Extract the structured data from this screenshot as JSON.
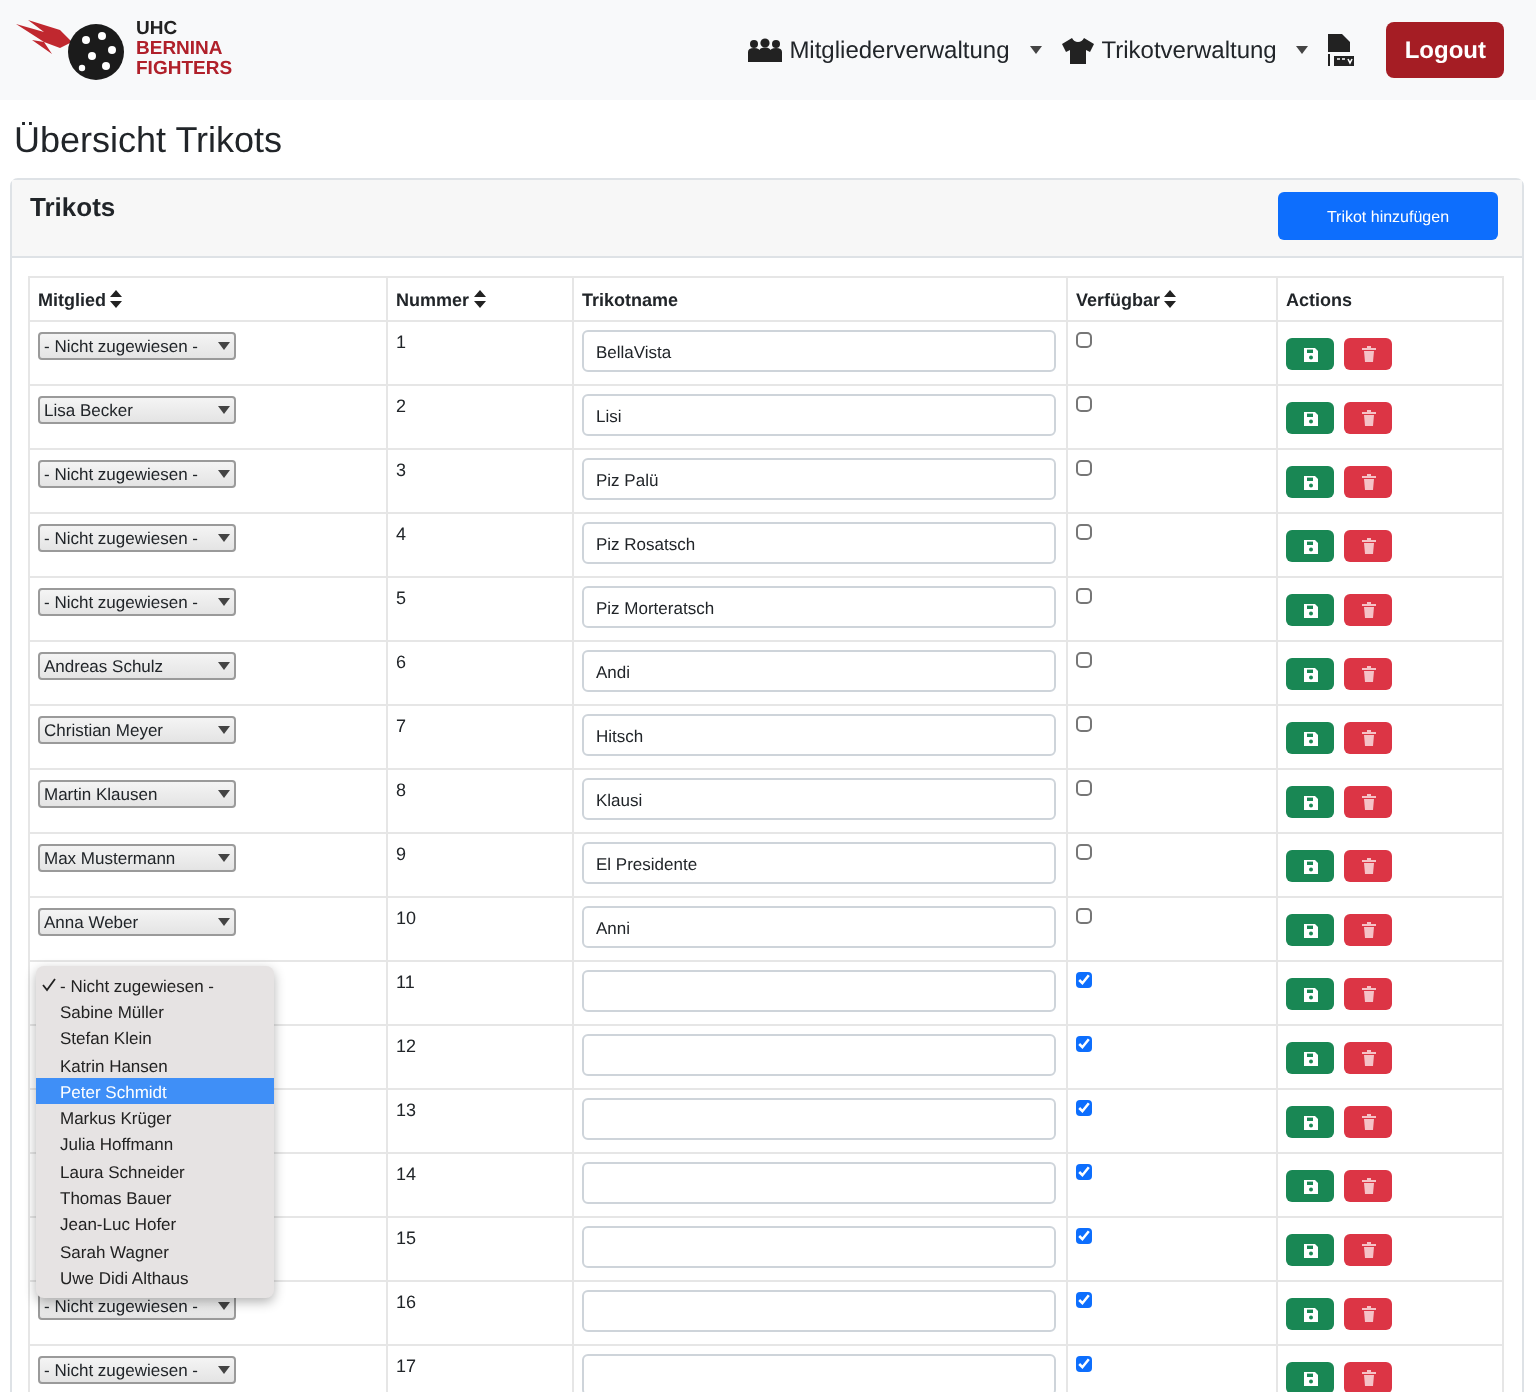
{
  "brand": {
    "line_1": "UHC",
    "line_2": "BERNINA",
    "line_3": "FIGHTERS"
  },
  "nav": [
    {
      "label": "Mitgliederverwaltung",
      "kind": "people"
    },
    {
      "label": "Trikotverwaltung",
      "kind": "shirt"
    }
  ],
  "logout": "Logout",
  "page_title": "Übersicht Trikots",
  "card": {
    "title": "Trikots",
    "add_button": "Trikot hinzufügen"
  },
  "table": {
    "columns": [
      {
        "label": "Mitglied",
        "sortable": true
      },
      {
        "label": "Nummer",
        "sortable": true
      },
      {
        "label": "Trikotname",
        "sortable": false
      },
      {
        "label": "Verfügbar",
        "sortable": true
      },
      {
        "label": "Actions",
        "sortable": false
      }
    ],
    "rows": [
      {
        "member": "- Nicht zugewiesen -",
        "number": "1",
        "name": "BellaVista",
        "available": false
      },
      {
        "member": "Lisa Becker",
        "number": "2",
        "name": "Lisi",
        "available": false
      },
      {
        "member": "- Nicht zugewiesen -",
        "number": "3",
        "name": "Piz Palü",
        "available": false
      },
      {
        "member": "- Nicht zugewiesen -",
        "number": "4",
        "name": "Piz Rosatsch",
        "available": false
      },
      {
        "member": "- Nicht zugewiesen -",
        "number": "5",
        "name": "Piz Morteratsch",
        "available": false
      },
      {
        "member": "Andreas Schulz",
        "number": "6",
        "name": "Andi",
        "available": false
      },
      {
        "member": "Christian Meyer",
        "number": "7",
        "name": "Hitsch",
        "available": false
      },
      {
        "member": "Martin Klausen",
        "number": "8",
        "name": "Klausi",
        "available": false
      },
      {
        "member": "Max Mustermann",
        "number": "9",
        "name": "El Presidente",
        "available": false
      },
      {
        "member": "Anna Weber",
        "number": "10",
        "name": "Anni",
        "available": false
      },
      {
        "number": "11",
        "available": true,
        "member_menu": [
          {
            "label": "- Nicht zugewiesen -",
            "checked": true,
            "selected": false
          },
          {
            "label": "Sabine Müller",
            "checked": false,
            "selected": false
          },
          {
            "label": "Stefan Klein",
            "checked": false,
            "selected": false
          },
          {
            "label": "Katrin Hansen",
            "checked": false,
            "selected": false
          },
          {
            "label": "Peter Schmidt",
            "checked": false,
            "selected": true
          },
          {
            "label": "Markus Krüger",
            "checked": false,
            "selected": false
          },
          {
            "label": "Julia Hoffmann",
            "checked": false,
            "selected": false
          },
          {
            "label": "Laura Schneider",
            "checked": false,
            "selected": false
          },
          {
            "label": "Thomas Bauer",
            "checked": false,
            "selected": false
          },
          {
            "label": "Jean-Luc Hofer",
            "checked": false,
            "selected": false
          },
          {
            "label": "Sarah Wagner",
            "checked": false,
            "selected": false
          },
          {
            "label": "Uwe Didi Althaus",
            "checked": false,
            "selected": false
          }
        ]
      },
      {
        "number": "12",
        "available": true
      },
      {
        "number": "13",
        "available": true
      },
      {
        "number": "14",
        "available": true
      },
      {
        "number": "15",
        "available": true
      },
      {
        "member": "- Nicht zugewiesen -",
        "number": "16",
        "available": true
      },
      {
        "member": "- Nicht zugewiesen -",
        "number": "17",
        "available": true
      }
    ]
  }
}
